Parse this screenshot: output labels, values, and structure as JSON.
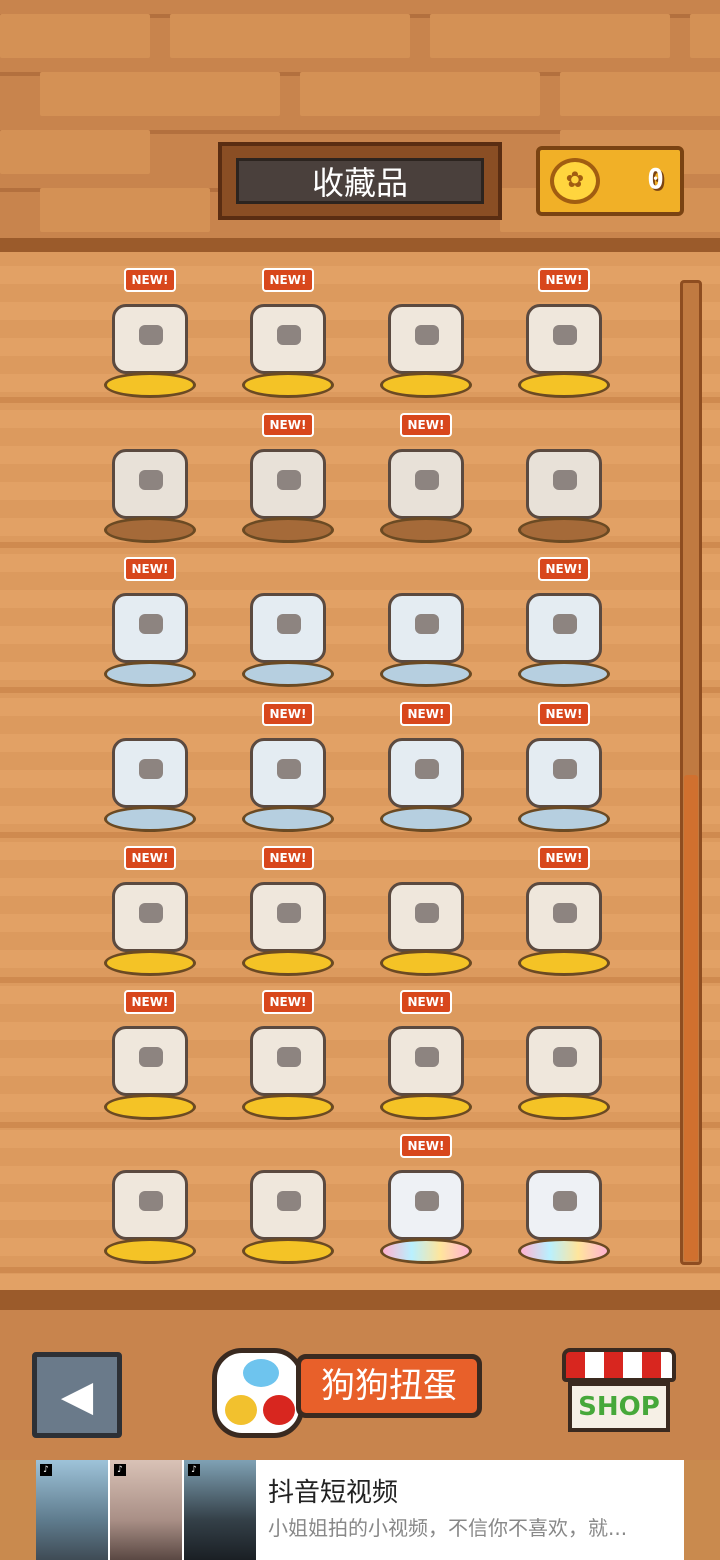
{
  "header": {
    "title": "收藏品",
    "coin_count": "0",
    "coin_icon": "paw-coin-icon"
  },
  "collection": {
    "rows": [
      [
        {
          "new": true,
          "stand": "gold",
          "name": "tea-table-dog"
        },
        {
          "new": true,
          "stand": "gold",
          "name": "red-water-globe"
        },
        {
          "new": false,
          "stand": "gold",
          "name": "dog-in-bed"
        },
        {
          "new": true,
          "stand": "gold",
          "name": "ball-pit-dogs"
        }
      ],
      [
        {
          "new": false,
          "stand": "brown",
          "name": "gray-dog"
        },
        {
          "new": true,
          "stand": "brown",
          "name": "hanging-dog-lamp"
        },
        {
          "new": true,
          "stand": "brown",
          "name": "cabinet"
        },
        {
          "new": false,
          "stand": "brown",
          "name": "plant-table"
        }
      ],
      [
        {
          "new": true,
          "stand": "blue",
          "name": "window-dog"
        },
        {
          "new": false,
          "stand": "blue",
          "name": "sleeping-dogs"
        },
        {
          "new": false,
          "stand": "blue",
          "name": "sofa-dogs"
        },
        {
          "new": true,
          "stand": "blue",
          "name": "round-window"
        }
      ],
      [
        {
          "new": false,
          "stand": "blue",
          "name": "arched-door"
        },
        {
          "new": true,
          "stand": "blue",
          "name": "armchair-dog"
        },
        {
          "new": true,
          "stand": "blue",
          "name": "tv-stand"
        },
        {
          "new": true,
          "stand": "blue",
          "name": "bowl-bed-dog"
        }
      ],
      [
        {
          "new": true,
          "stand": "gold",
          "name": "fireplace"
        },
        {
          "new": true,
          "stand": "gold",
          "name": "dinner-dogs"
        },
        {
          "new": false,
          "stand": "gold",
          "name": "blue-water-globe"
        },
        {
          "new": true,
          "stand": "gold",
          "name": "bathtub-dogs"
        }
      ],
      [
        {
          "new": true,
          "stand": "gold",
          "name": "hat-dog"
        },
        {
          "new": true,
          "stand": "gold",
          "name": "moon-dog"
        },
        {
          "new": true,
          "stand": "gold",
          "name": "parachute-orange-dog"
        },
        {
          "new": false,
          "stand": "gold",
          "name": "parachute-gray-dog"
        }
      ],
      [
        {
          "new": false,
          "stand": "gold",
          "name": "bed-dog"
        },
        {
          "new": false,
          "stand": "gold",
          "name": "reading-dog"
        },
        {
          "new": true,
          "stand": "rainbow",
          "name": "bone-dog"
        },
        {
          "new": false,
          "stand": "rainbow",
          "name": "dogs-with-hat"
        }
      ]
    ],
    "new_label": "NEW!"
  },
  "footer": {
    "back_icon": "back-arrow-icon",
    "gacha_label": "狗狗扭蛋",
    "shop_label": "SHOP"
  },
  "ad": {
    "title": "抖音短视频",
    "description": "小姐姐拍的小视频，不信你不喜欢，就..."
  }
}
